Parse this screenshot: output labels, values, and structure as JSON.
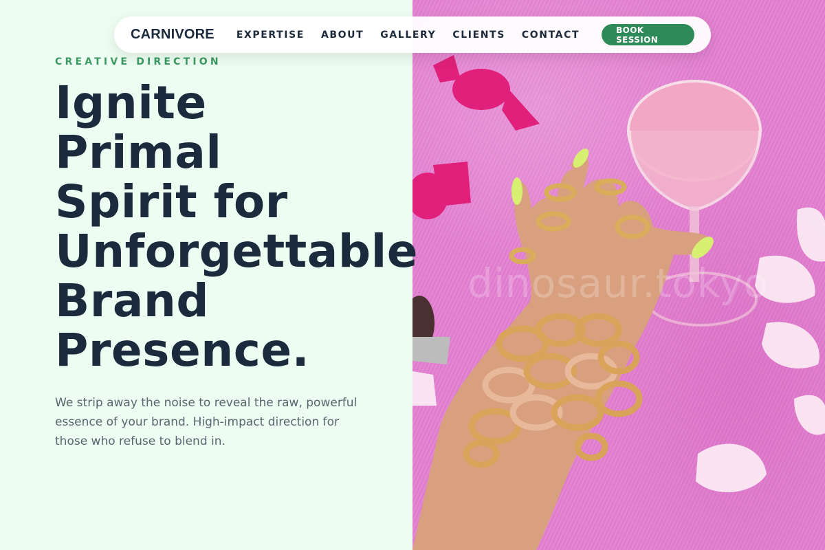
{
  "nav": {
    "logo": "CARNIVORE",
    "links": [
      "EXPERTISE",
      "ABOUT",
      "GALLERY",
      "CLIENTS",
      "CONTACT"
    ],
    "cta": "BOOK SESSION"
  },
  "hero": {
    "eyebrow": "CREATIVE DIRECTION",
    "headline_lines": [
      "Ignite",
      "Primal",
      "Spirit for",
      "Unforgettable",
      "Brand",
      "Presence."
    ],
    "body": "We strip away the noise to reveal the raw, powerful essence of your brand. High-impact direction for those who refuse to blend in."
  },
  "image": {
    "watermark": "dinosaur.tokyo",
    "icon": "hand-with-jewelry-photo"
  },
  "colors": {
    "background": "#eefdf1",
    "text_dark": "#1c2a3d",
    "accent_green": "#2f8a5a",
    "eyebrow_green": "#3a9a62",
    "body_gray": "#5b6470",
    "photo_pink": "#e27fcf"
  }
}
